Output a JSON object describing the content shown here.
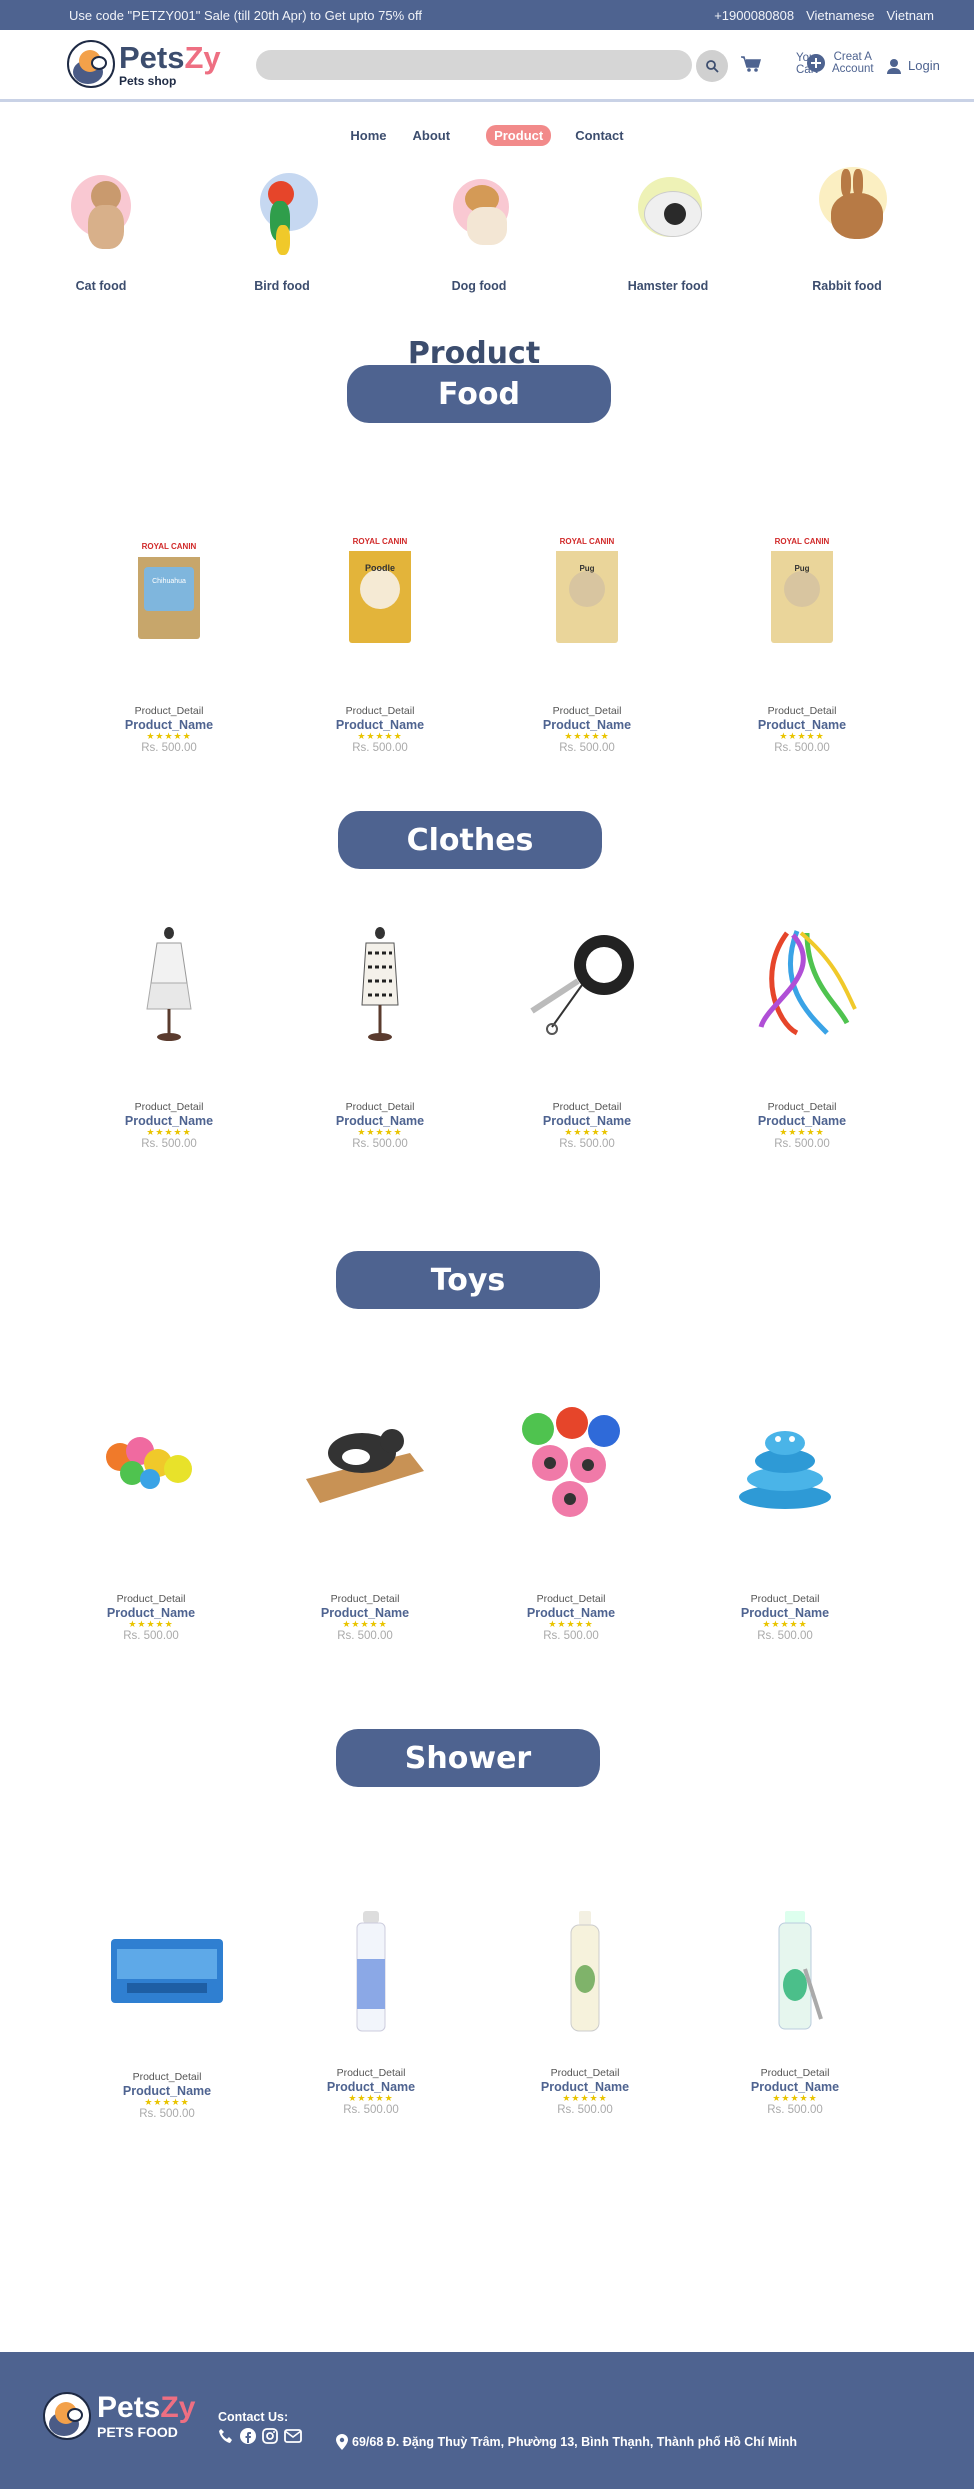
{
  "topbar": {
    "promo": "Use code \"PETZY001\" Sale (till 20th Apr) to Get upto 75% off",
    "phone": "+1900080808",
    "language": "Vietnamese",
    "country": "Vietnam"
  },
  "header": {
    "logo_pets": "Pets",
    "logo_zy": "Zy",
    "logo_sub": "Pets shop",
    "search_placeholder": "",
    "cart_label_1": "Your",
    "cart_label_2": "Cart",
    "account_label_1": "Creat A",
    "account_label_2": "Account",
    "login_label": "Login"
  },
  "nav": {
    "home": "Home",
    "about": "About",
    "product": "Product",
    "contact": "Contact"
  },
  "categories": [
    {
      "label": "Cat food"
    },
    {
      "label": "Bird food"
    },
    {
      "label": "Dog food"
    },
    {
      "label": "Hamster food"
    },
    {
      "label": "Rabbit food"
    }
  ],
  "page_title": "Product",
  "sections": {
    "food": "Food",
    "clothes": "Clothes",
    "toys": "Toys",
    "shower": "Shower"
  },
  "product_card": {
    "detail": "Product_Detail",
    "name": "Product_Name",
    "stars": "★★★★★",
    "price": "Rs. 500.00"
  },
  "brand_label": "ROYAL CANIN",
  "food_labels": [
    "Chihuahua",
    "Poodle",
    "Pug",
    "Pug"
  ],
  "footer": {
    "logo_pets": "Pets",
    "logo_zy": "Zy",
    "logo_sub": "PETS FOOD",
    "contact_title": "Contact Us:",
    "address": "69/68 Đ. Đặng Thuỳ Trâm, Phường 13, Bình Thạnh, Thành phố Hồ Chí Minh"
  },
  "colors": {
    "primary": "#4e6390",
    "accent_pink": "#ee6f82",
    "nav_active": "#f28a8a",
    "star": "#e9c400"
  }
}
